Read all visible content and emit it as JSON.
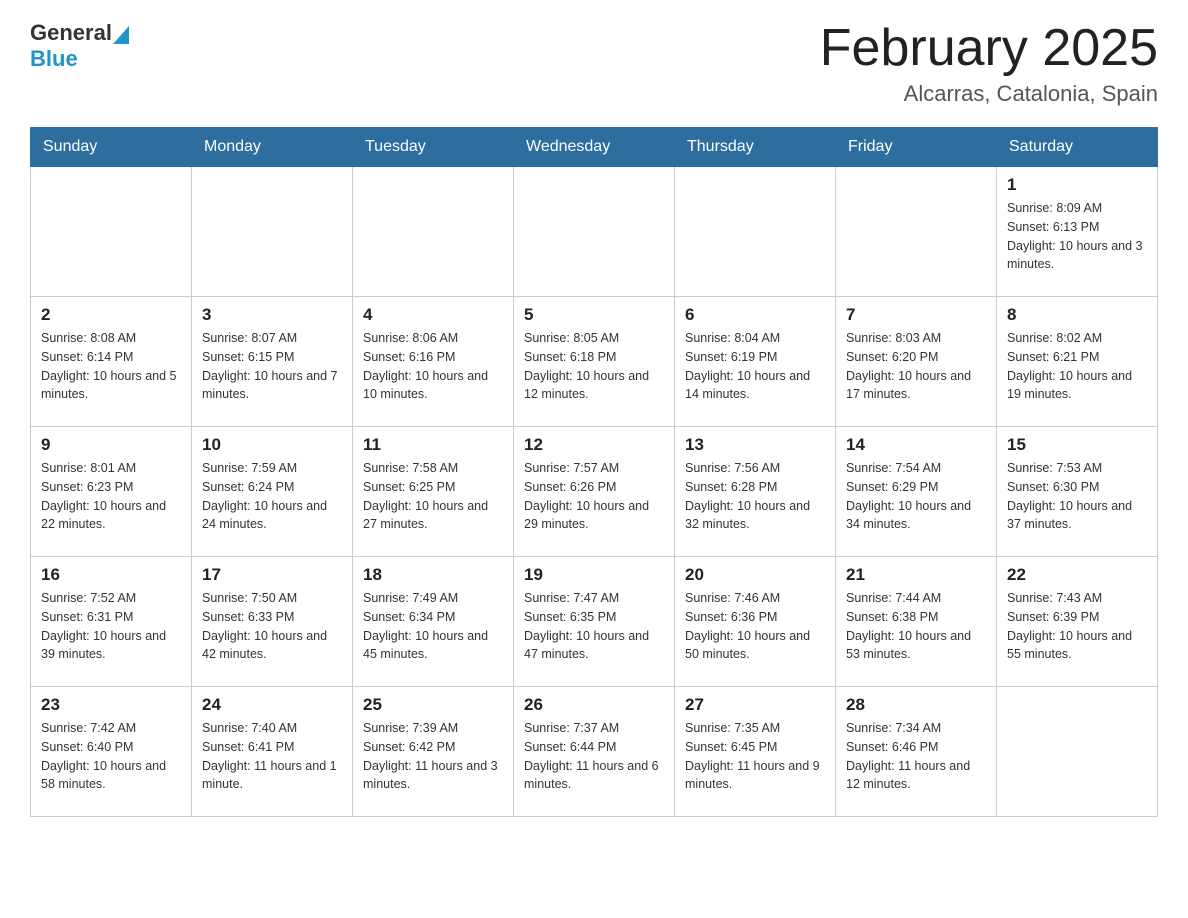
{
  "header": {
    "logo_general": "General",
    "logo_blue": "Blue",
    "month_title": "February 2025",
    "location": "Alcarras, Catalonia, Spain"
  },
  "weekdays": [
    "Sunday",
    "Monday",
    "Tuesday",
    "Wednesday",
    "Thursday",
    "Friday",
    "Saturday"
  ],
  "weeks": [
    [
      {
        "day": "",
        "info": ""
      },
      {
        "day": "",
        "info": ""
      },
      {
        "day": "",
        "info": ""
      },
      {
        "day": "",
        "info": ""
      },
      {
        "day": "",
        "info": ""
      },
      {
        "day": "",
        "info": ""
      },
      {
        "day": "1",
        "info": "Sunrise: 8:09 AM\nSunset: 6:13 PM\nDaylight: 10 hours and 3 minutes."
      }
    ],
    [
      {
        "day": "2",
        "info": "Sunrise: 8:08 AM\nSunset: 6:14 PM\nDaylight: 10 hours and 5 minutes."
      },
      {
        "day": "3",
        "info": "Sunrise: 8:07 AM\nSunset: 6:15 PM\nDaylight: 10 hours and 7 minutes."
      },
      {
        "day": "4",
        "info": "Sunrise: 8:06 AM\nSunset: 6:16 PM\nDaylight: 10 hours and 10 minutes."
      },
      {
        "day": "5",
        "info": "Sunrise: 8:05 AM\nSunset: 6:18 PM\nDaylight: 10 hours and 12 minutes."
      },
      {
        "day": "6",
        "info": "Sunrise: 8:04 AM\nSunset: 6:19 PM\nDaylight: 10 hours and 14 minutes."
      },
      {
        "day": "7",
        "info": "Sunrise: 8:03 AM\nSunset: 6:20 PM\nDaylight: 10 hours and 17 minutes."
      },
      {
        "day": "8",
        "info": "Sunrise: 8:02 AM\nSunset: 6:21 PM\nDaylight: 10 hours and 19 minutes."
      }
    ],
    [
      {
        "day": "9",
        "info": "Sunrise: 8:01 AM\nSunset: 6:23 PM\nDaylight: 10 hours and 22 minutes."
      },
      {
        "day": "10",
        "info": "Sunrise: 7:59 AM\nSunset: 6:24 PM\nDaylight: 10 hours and 24 minutes."
      },
      {
        "day": "11",
        "info": "Sunrise: 7:58 AM\nSunset: 6:25 PM\nDaylight: 10 hours and 27 minutes."
      },
      {
        "day": "12",
        "info": "Sunrise: 7:57 AM\nSunset: 6:26 PM\nDaylight: 10 hours and 29 minutes."
      },
      {
        "day": "13",
        "info": "Sunrise: 7:56 AM\nSunset: 6:28 PM\nDaylight: 10 hours and 32 minutes."
      },
      {
        "day": "14",
        "info": "Sunrise: 7:54 AM\nSunset: 6:29 PM\nDaylight: 10 hours and 34 minutes."
      },
      {
        "day": "15",
        "info": "Sunrise: 7:53 AM\nSunset: 6:30 PM\nDaylight: 10 hours and 37 minutes."
      }
    ],
    [
      {
        "day": "16",
        "info": "Sunrise: 7:52 AM\nSunset: 6:31 PM\nDaylight: 10 hours and 39 minutes."
      },
      {
        "day": "17",
        "info": "Sunrise: 7:50 AM\nSunset: 6:33 PM\nDaylight: 10 hours and 42 minutes."
      },
      {
        "day": "18",
        "info": "Sunrise: 7:49 AM\nSunset: 6:34 PM\nDaylight: 10 hours and 45 minutes."
      },
      {
        "day": "19",
        "info": "Sunrise: 7:47 AM\nSunset: 6:35 PM\nDaylight: 10 hours and 47 minutes."
      },
      {
        "day": "20",
        "info": "Sunrise: 7:46 AM\nSunset: 6:36 PM\nDaylight: 10 hours and 50 minutes."
      },
      {
        "day": "21",
        "info": "Sunrise: 7:44 AM\nSunset: 6:38 PM\nDaylight: 10 hours and 53 minutes."
      },
      {
        "day": "22",
        "info": "Sunrise: 7:43 AM\nSunset: 6:39 PM\nDaylight: 10 hours and 55 minutes."
      }
    ],
    [
      {
        "day": "23",
        "info": "Sunrise: 7:42 AM\nSunset: 6:40 PM\nDaylight: 10 hours and 58 minutes."
      },
      {
        "day": "24",
        "info": "Sunrise: 7:40 AM\nSunset: 6:41 PM\nDaylight: 11 hours and 1 minute."
      },
      {
        "day": "25",
        "info": "Sunrise: 7:39 AM\nSunset: 6:42 PM\nDaylight: 11 hours and 3 minutes."
      },
      {
        "day": "26",
        "info": "Sunrise: 7:37 AM\nSunset: 6:44 PM\nDaylight: 11 hours and 6 minutes."
      },
      {
        "day": "27",
        "info": "Sunrise: 7:35 AM\nSunset: 6:45 PM\nDaylight: 11 hours and 9 minutes."
      },
      {
        "day": "28",
        "info": "Sunrise: 7:34 AM\nSunset: 6:46 PM\nDaylight: 11 hours and 12 minutes."
      },
      {
        "day": "",
        "info": ""
      }
    ]
  ]
}
